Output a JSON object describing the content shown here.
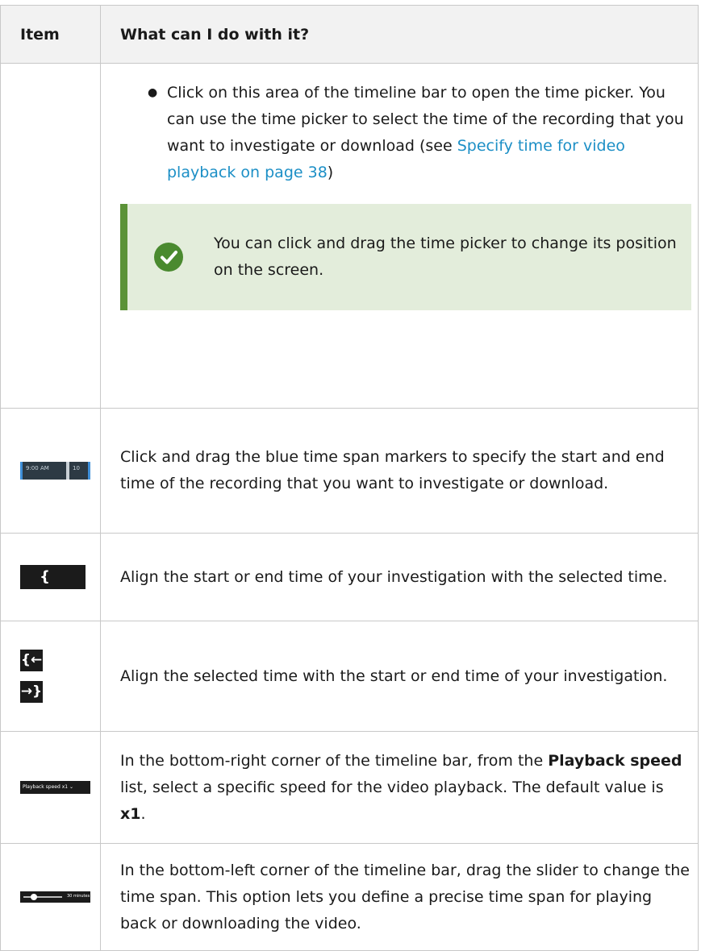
{
  "table": {
    "headers": [
      "Item",
      "What can I do with it?"
    ],
    "row1": {
      "bullet": "Click on this area of the timeline bar to open the time picker. You can use the time picker to select the time of the recording that you want to investigate or download (see ",
      "link": "Specify time for video playback on page 38",
      "bullet_end": ")",
      "tip": "You can click and drag the time picker to change its position on the screen.",
      "tip_icon": "check-circle-icon"
    },
    "row2": {
      "icon_text_left": "9:00 AM",
      "icon_text_right": "10",
      "text": "Click and drag the blue time span markers to specify the start and end time of the recording that you want to investigate or download."
    },
    "row3": {
      "icon_glyph": "{ }",
      "text": "Align the start or end time of your investigation with the selected time."
    },
    "row4": {
      "icon_glyph_top": "{←",
      "icon_glyph_bottom": "→}",
      "text": "Align the selected time with the start or end time of your investigation."
    },
    "row5": {
      "icon_text": "Playback speed x1  ⌄",
      "text_before": "In the bottom-right corner of the timeline bar, from the ",
      "bold1": "Playback speed",
      "text_middle": " list, select a specific speed for the video playback. The default value is ",
      "bold2": "x1",
      "text_end": "."
    },
    "row6": {
      "icon_text": "30 minutes",
      "text": "In the bottom-left corner of the timeline bar, drag the slider to change the time span. This option lets you define a precise time span for playing back or downloading the video."
    }
  },
  "colors": {
    "link": "#1c8fc6",
    "tip_background": "#e3eddb",
    "tip_border": "#5b9237",
    "check_icon": "#4a8a2f"
  }
}
